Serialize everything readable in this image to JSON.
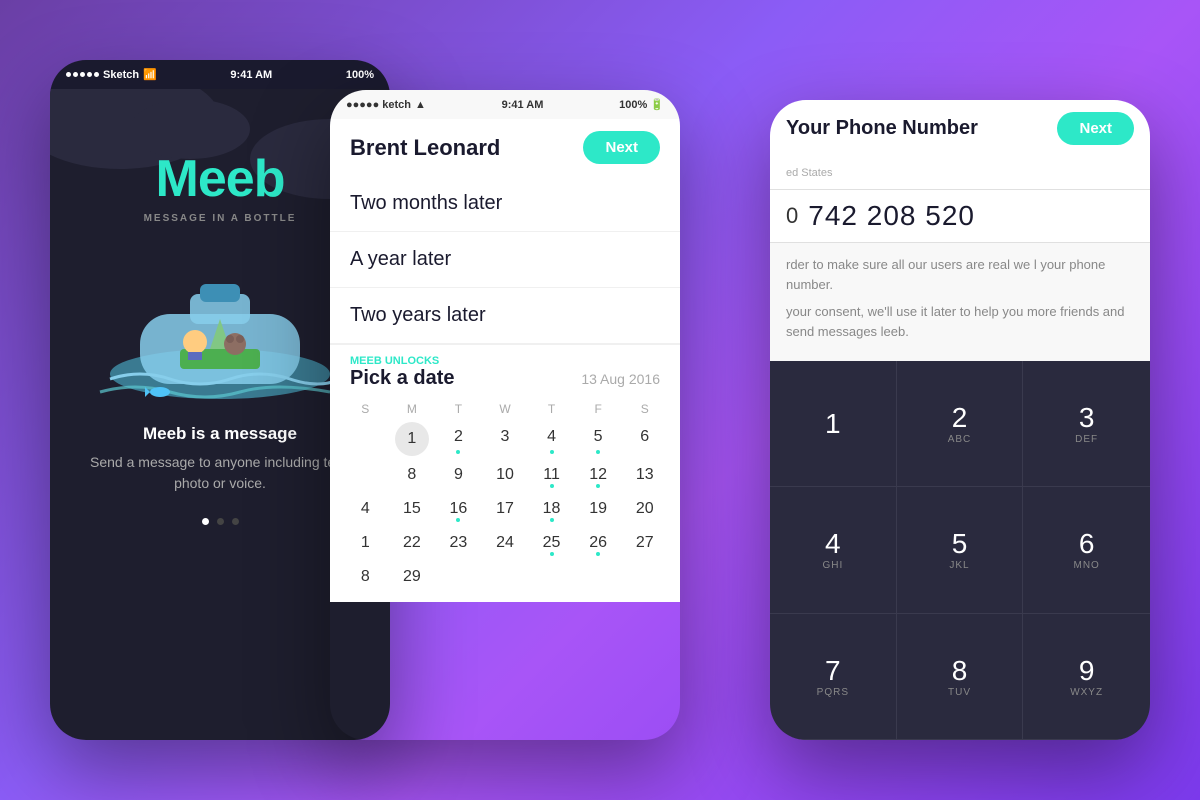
{
  "background": {
    "gradient": "purple to violet"
  },
  "phone1": {
    "status": {
      "carrier": "Sketch",
      "wifi": "wifi",
      "time": "9:41 AM",
      "battery": "100%"
    },
    "logo": "Meeb",
    "tagline": "MESSAGE IN A BOTTLE",
    "tagline2": "Meeb is a message",
    "description": "Send a message to anyone including text, photo or voice.",
    "dots": [
      "active",
      "inactive",
      "inactive"
    ]
  },
  "phone2": {
    "status": {
      "carrier": "ketch",
      "wifi": "wifi",
      "time": "9:41 AM",
      "battery": "100%"
    },
    "header": {
      "name": "Brent Leonard",
      "next_label": "Next"
    },
    "time_options": [
      "Two months later",
      "A year later",
      "Two years later"
    ],
    "calendar": {
      "label": "Meeb Unlocks",
      "title": "Pick a date",
      "date": "13 Aug 2016",
      "days_header": [
        "S",
        "M",
        "T",
        "W",
        "T",
        "F",
        "S"
      ],
      "weeks": [
        [
          "",
          "1",
          "2",
          "3",
          "4",
          "5",
          "6"
        ],
        [
          "",
          "8",
          "9",
          "10",
          "11",
          "12",
          "13"
        ],
        [
          "4",
          "15",
          "16",
          "17",
          "18",
          "19",
          "20"
        ],
        [
          "1",
          "22",
          "23",
          "24",
          "25",
          "26",
          "27"
        ],
        [
          "8",
          "29",
          "",
          "",
          "",
          "",
          ""
        ]
      ],
      "dots": [
        "2",
        "4",
        "5",
        "11",
        "16",
        "18",
        "25",
        "26"
      ]
    }
  },
  "phone3": {
    "header": {
      "title": "Your Phone Number",
      "next_label": "Next"
    },
    "country": {
      "label": "ed States",
      "code": "0",
      "number": "742 208 520"
    },
    "desc1": "rder to make sure all our users are real we l your phone number.",
    "desc2": "your consent, we'll use it later to help you more friends and send messages leeb.",
    "keypad": [
      {
        "num": "1",
        "letters": ""
      },
      {
        "num": "2",
        "letters": "ABC"
      },
      {
        "num": "3",
        "letters": "DEF"
      },
      {
        "num": "4",
        "letters": "GHI"
      },
      {
        "num": "5",
        "letters": "JKL"
      },
      {
        "num": "6",
        "letters": "MNO"
      },
      {
        "num": "7",
        "letters": "PQRS"
      },
      {
        "num": "8",
        "letters": "TUV"
      },
      {
        "num": "9",
        "letters": "WXYZ"
      }
    ]
  }
}
